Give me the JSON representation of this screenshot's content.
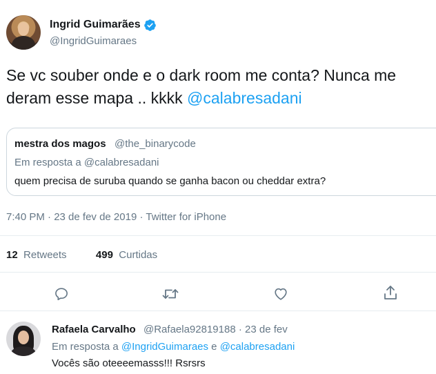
{
  "tweet": {
    "author_name": "Ingrid Guimarães",
    "author_handle": "@IngridGuimaraes",
    "text": "Se vc souber onde e o dark room me conta? Nunca me deram esse mapa .. kkkk ",
    "mention": "@calabresadani",
    "timestamp": "7:40 PM · 23 de fev de 2019 · Twitter for iPhone",
    "retweets_count": "12",
    "retweets_label": "Retweets",
    "likes_count": "499",
    "likes_label": "Curtidas"
  },
  "quoted": {
    "name": "mestra dos magos",
    "handle": "@the_binarycode",
    "reply_to": "Em resposta a @calabresadani",
    "text": "quem precisa de suruba quando se ganha bacon ou cheddar extra?"
  },
  "reply": {
    "name": "Rafaela Carvalho",
    "handle_date": "@Rafaela92819188 · 23 de fev",
    "reply_prefix": "Em resposta a ",
    "reply_mention_1": "@IngridGuimaraes",
    "reply_conj": " e ",
    "reply_mention_2": "@calabresadani",
    "text": "Vocês são oteeeemasss!!! Rsrsrs"
  },
  "icons": {
    "verified": "verified-badge-icon",
    "reply": "reply-icon",
    "retweet": "retweet-icon",
    "like": "like-icon",
    "share": "share-icon"
  },
  "colors": {
    "accent": "#1da1f2",
    "secondary_text": "#657786",
    "border": "#e6ecf0"
  }
}
